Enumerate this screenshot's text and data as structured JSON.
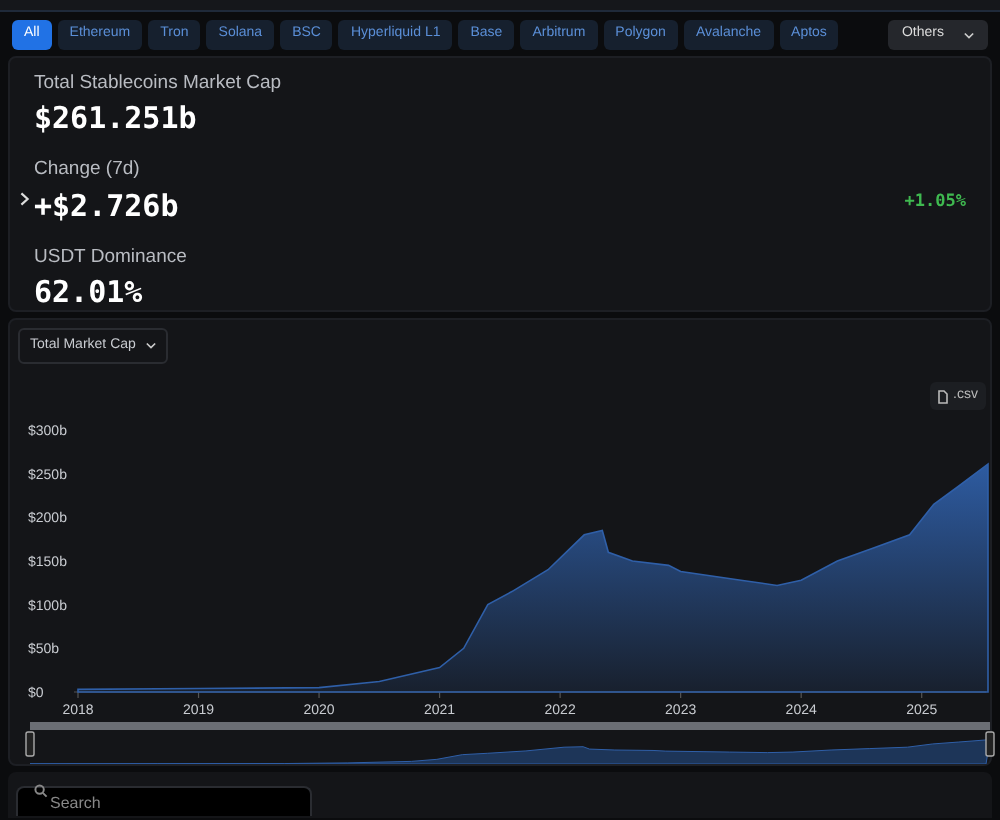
{
  "chain_tabs": [
    {
      "label": "All",
      "selected": true
    },
    {
      "label": "Ethereum",
      "selected": false
    },
    {
      "label": "Tron",
      "selected": false
    },
    {
      "label": "Solana",
      "selected": false
    },
    {
      "label": "BSC",
      "selected": false
    },
    {
      "label": "Hyperliquid L1",
      "selected": false
    },
    {
      "label": "Base",
      "selected": false
    },
    {
      "label": "Arbitrum",
      "selected": false
    },
    {
      "label": "Polygon",
      "selected": false
    },
    {
      "label": "Avalanche",
      "selected": false
    },
    {
      "label": "Aptos",
      "selected": false
    }
  ],
  "others_menu": {
    "label": "Others"
  },
  "stats": [
    {
      "label": "Total Stablecoins Market Cap",
      "value": "$261.251b",
      "expandable": false
    },
    {
      "label": "Change (7d)",
      "value": "+$2.726b",
      "expandable": true,
      "percent": "+1.05%"
    },
    {
      "label": "USDT Dominance",
      "value": "62.01%",
      "expandable": false
    }
  ],
  "chart_panel": {
    "metric_select": "Total Market Cap",
    "csv_button": ".csv",
    "chart_data": {
      "type": "area",
      "x": [
        2018,
        2019,
        2020,
        2020.5,
        2021,
        2021.2,
        2021.4,
        2021.6,
        2021.9,
        2022.2,
        2022.35,
        2022.4,
        2022.6,
        2022.9,
        2023,
        2023.5,
        2023.8,
        2024,
        2024.3,
        2024.6,
        2024.9,
        2025.1,
        2025.3,
        2025.55
      ],
      "series": [
        {
          "color": "#2f5fa8",
          "values": [
            3,
            4,
            5,
            12,
            28,
            50,
            100,
            115,
            140,
            180,
            185,
            160,
            150,
            145,
            138,
            128,
            122,
            128,
            150,
            165,
            180,
            215,
            235,
            261
          ]
        }
      ],
      "xticks": [
        2018,
        2019,
        2020,
        2021,
        2022,
        2023,
        2024,
        2025
      ],
      "yticks": [
        {
          "value": 0,
          "label": "$0"
        },
        {
          "value": 50,
          "label": "$50b"
        },
        {
          "value": 100,
          "label": "$100b"
        },
        {
          "value": 150,
          "label": "$150b"
        },
        {
          "value": 200,
          "label": "$200b"
        },
        {
          "value": 250,
          "label": "$250b"
        },
        {
          "value": 300,
          "label": "$300b"
        }
      ],
      "xlim": [
        2018,
        2025.55
      ],
      "ylim": [
        0,
        300
      ]
    }
  },
  "search": {
    "placeholder": "Search"
  }
}
